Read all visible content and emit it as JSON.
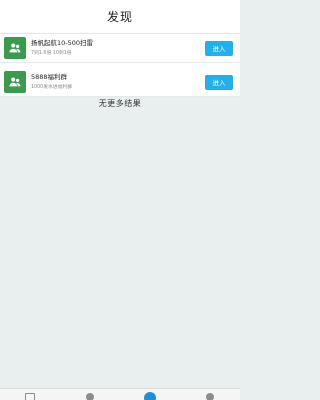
{
  "header": {
    "title": "发现"
  },
  "colors": {
    "thumb_green": "#3c9a4e",
    "button_blue": "#21b0ec"
  },
  "groups": [
    {
      "name": "扬帆起航10-500扫雷",
      "meta": "7到1.6倍 10到1倍",
      "button_label": "进入",
      "icon": "people-icon"
    },
    {
      "name": "5888福利群",
      "meta": "1000发水进福利群",
      "button_label": "进入",
      "icon": "people-icon"
    }
  ],
  "list_end": {
    "text": "无更多结果"
  },
  "tabbar": {
    "tabs": [
      {
        "icon": "document-icon"
      },
      {
        "icon": "contacts-icon"
      },
      {
        "icon": "discover-icon",
        "active": true
      },
      {
        "icon": "profile-icon"
      }
    ]
  }
}
